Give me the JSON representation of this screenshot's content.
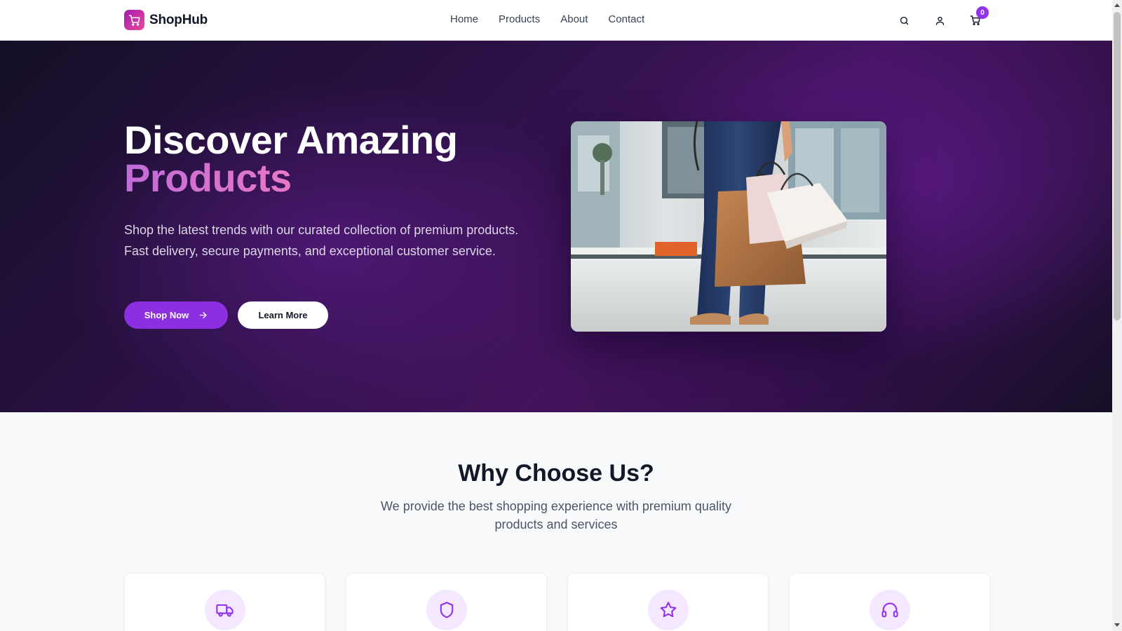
{
  "brand": {
    "name": "ShopHub",
    "logo_icon": "shopping-cart-icon",
    "colors": {
      "primary": "#8b2fe0",
      "accent_gradient_start": "#c06cd9",
      "accent_gradient_end": "#f472b6"
    }
  },
  "nav": {
    "items": [
      {
        "label": "Home"
      },
      {
        "label": "Products"
      },
      {
        "label": "About"
      },
      {
        "label": "Contact"
      }
    ]
  },
  "header_icons": {
    "search": "search-icon",
    "account": "user-icon",
    "cart": "shopping-cart-icon",
    "cart_count": "0"
  },
  "hero": {
    "title_line1": "Discover Amazing",
    "title_line2": "Products",
    "description": "Shop the latest trends with our curated collection of premium products. Fast delivery, secure payments, and exceptional customer service.",
    "primary_button": "Shop Now",
    "primary_button_icon": "arrow-right-icon",
    "secondary_button": "Learn More",
    "image_alt": "Person holding shopping bags"
  },
  "why": {
    "title": "Why Choose Us?",
    "subtitle": "We provide the best shopping experience with premium quality products and services",
    "features": [
      {
        "icon": "truck-icon"
      },
      {
        "icon": "shield-icon"
      },
      {
        "icon": "star-icon"
      },
      {
        "icon": "headphones-icon"
      }
    ]
  }
}
